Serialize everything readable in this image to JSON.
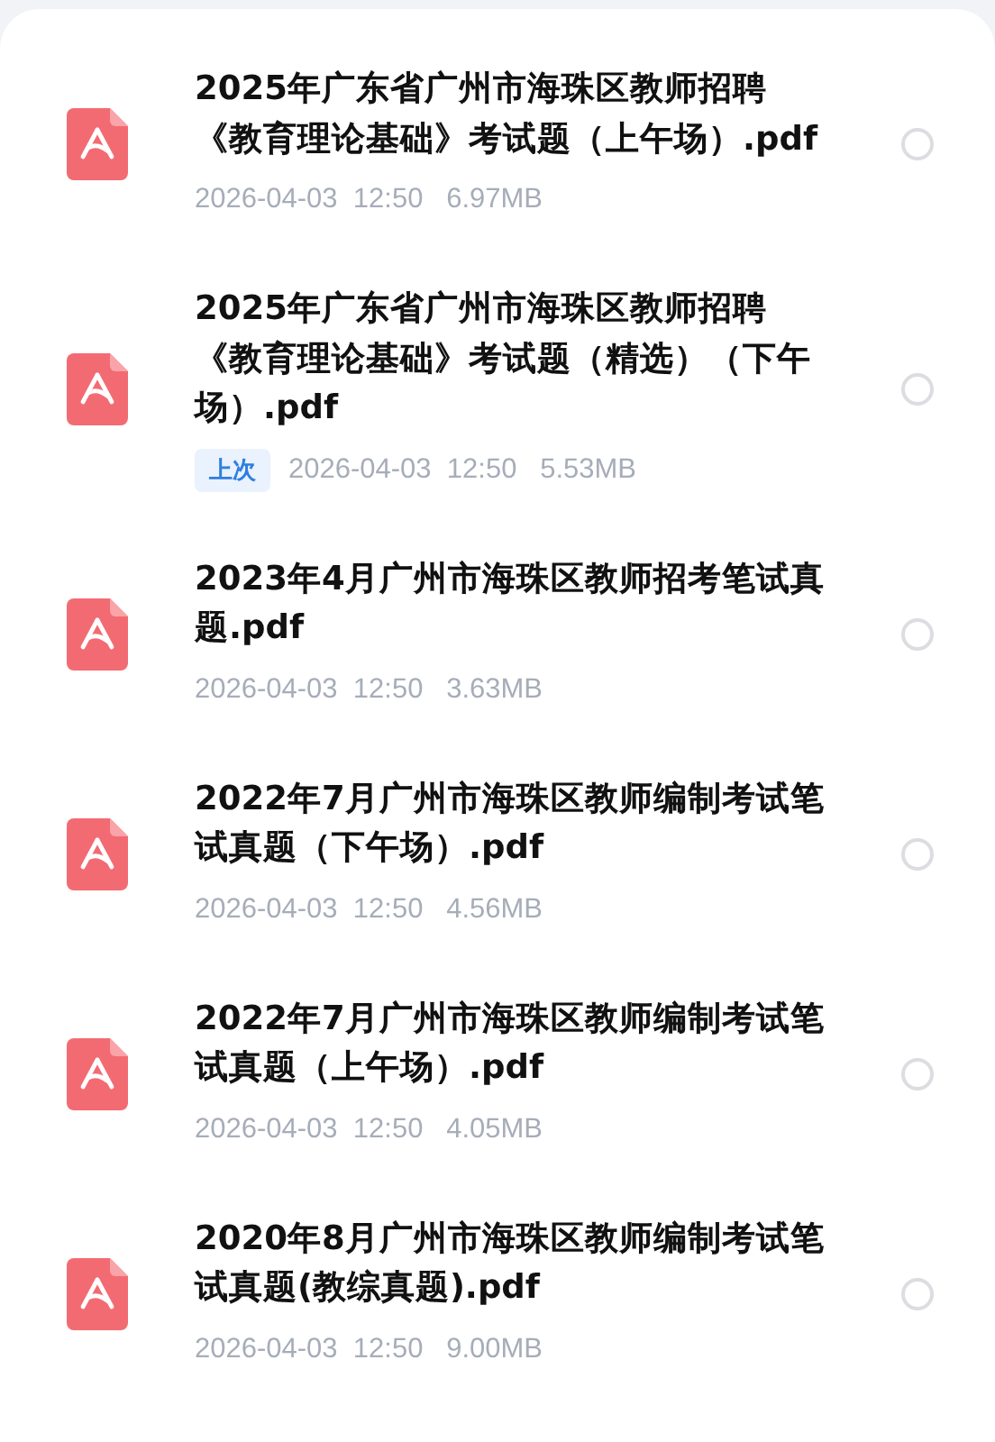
{
  "files": [
    {
      "title": "2025年广东省广州市海珠区教师招聘《教育理论基础》考试题（上午场）.pdf",
      "last_opened": false,
      "meta": "2026-04-03  12:50   6.97MB",
      "selected": false
    },
    {
      "title": "2025年广东省广州市海珠区教师招聘《教育理论基础》考试题（精选）（下午场）.pdf",
      "last_opened": true,
      "badge": "上次",
      "meta": "2026-04-03  12:50   5.53MB",
      "selected": false
    },
    {
      "title": "2023年4月广州市海珠区教师招考笔试真题.pdf",
      "last_opened": false,
      "meta": "2026-04-03  12:50   3.63MB",
      "selected": false
    },
    {
      "title": "2022年7月广州市海珠区教师编制考试笔试真题（下午场）.pdf",
      "last_opened": false,
      "meta": "2026-04-03  12:50   4.56MB",
      "selected": false
    },
    {
      "title": "2022年7月广州市海珠区教师编制考试笔试真题（上午场）.pdf",
      "last_opened": false,
      "meta": "2026-04-03  12:50   4.05MB",
      "selected": false
    },
    {
      "title": "2020年8月广州市海珠区教师编制考试笔试真题(教综真题).pdf",
      "last_opened": false,
      "meta": "2026-04-03  12:50   9.00MB",
      "selected": false
    }
  ]
}
